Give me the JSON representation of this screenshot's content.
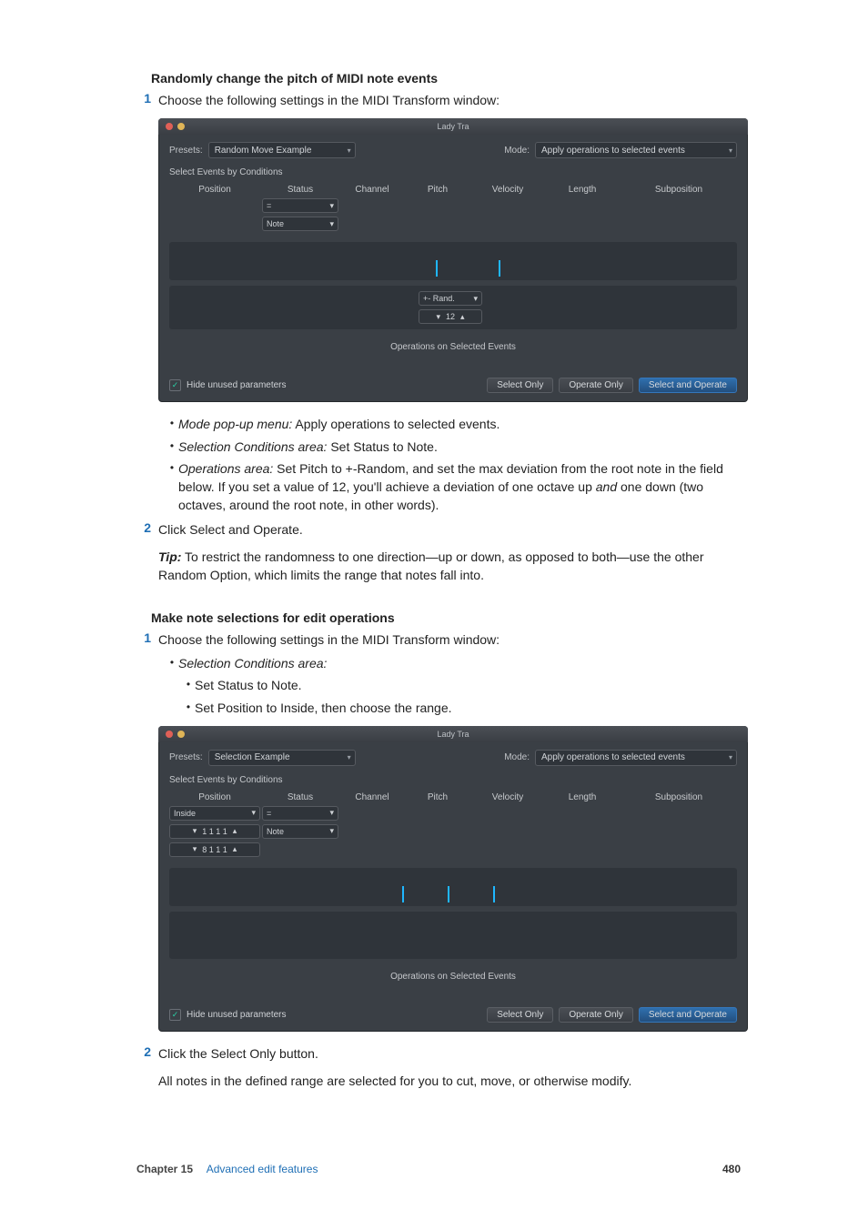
{
  "section1": {
    "title": "Randomly change the pitch of MIDI note events",
    "step1": "Choose the following settings in the MIDI Transform window:",
    "bullets": [
      {
        "lead": "Mode pop-up menu:",
        "rest": " Apply operations to selected events."
      },
      {
        "lead": "Selection Conditions area:",
        "rest": " Set Status to Note."
      },
      {
        "lead": "Operations area:",
        "rest": " Set Pitch to +-Random, and set the max deviation from the root note in the field below. If you set a value of 12, you'll achieve a deviation of one octave up and one down (two octaves, around the root note, in other words)."
      }
    ],
    "step2": "Click Select and Operate.",
    "tip_label": "Tip:",
    "tip_body": "  To restrict the randomness to one direction—up or down, as opposed to both—use the other Random Option, which limits the range that notes fall into."
  },
  "section2": {
    "title": "Make note selections for edit operations",
    "step1": "Choose the following settings in the MIDI Transform window:",
    "cond_lead": "Selection Conditions area:",
    "subs": [
      "Set Status to Note.",
      "Set Position to Inside, then choose the range."
    ],
    "step2": "Click the Select Only button.",
    "para": "All notes in the defined range are selected for you to cut, move, or otherwise modify."
  },
  "mock": {
    "title": "Lady Tra",
    "presets_label": "Presets:",
    "preset1": "Random Move Example",
    "preset2": "Selection Example",
    "mode_label": "Mode:",
    "mode_value": "Apply operations to selected events",
    "select_events": "Select Events by Conditions",
    "cols": [
      "Position",
      "Status",
      "Channel",
      "Pitch",
      "Velocity",
      "Length",
      "Subposition"
    ],
    "status_eq": "=",
    "status_note": "Note",
    "pos_inside": "Inside",
    "pos_a": "1 1 1   1",
    "pos_b": "8 1 1   1",
    "op_rand": "+- Rand.",
    "op_val": "12",
    "ops_title": "Operations on Selected Events",
    "hide": "Hide unused parameters",
    "btn_select": "Select Only",
    "btn_operate": "Operate Only",
    "btn_both": "Select and Operate"
  },
  "footer": {
    "chapter": "Chapter  15",
    "link": "Advanced edit features",
    "page": "480"
  }
}
